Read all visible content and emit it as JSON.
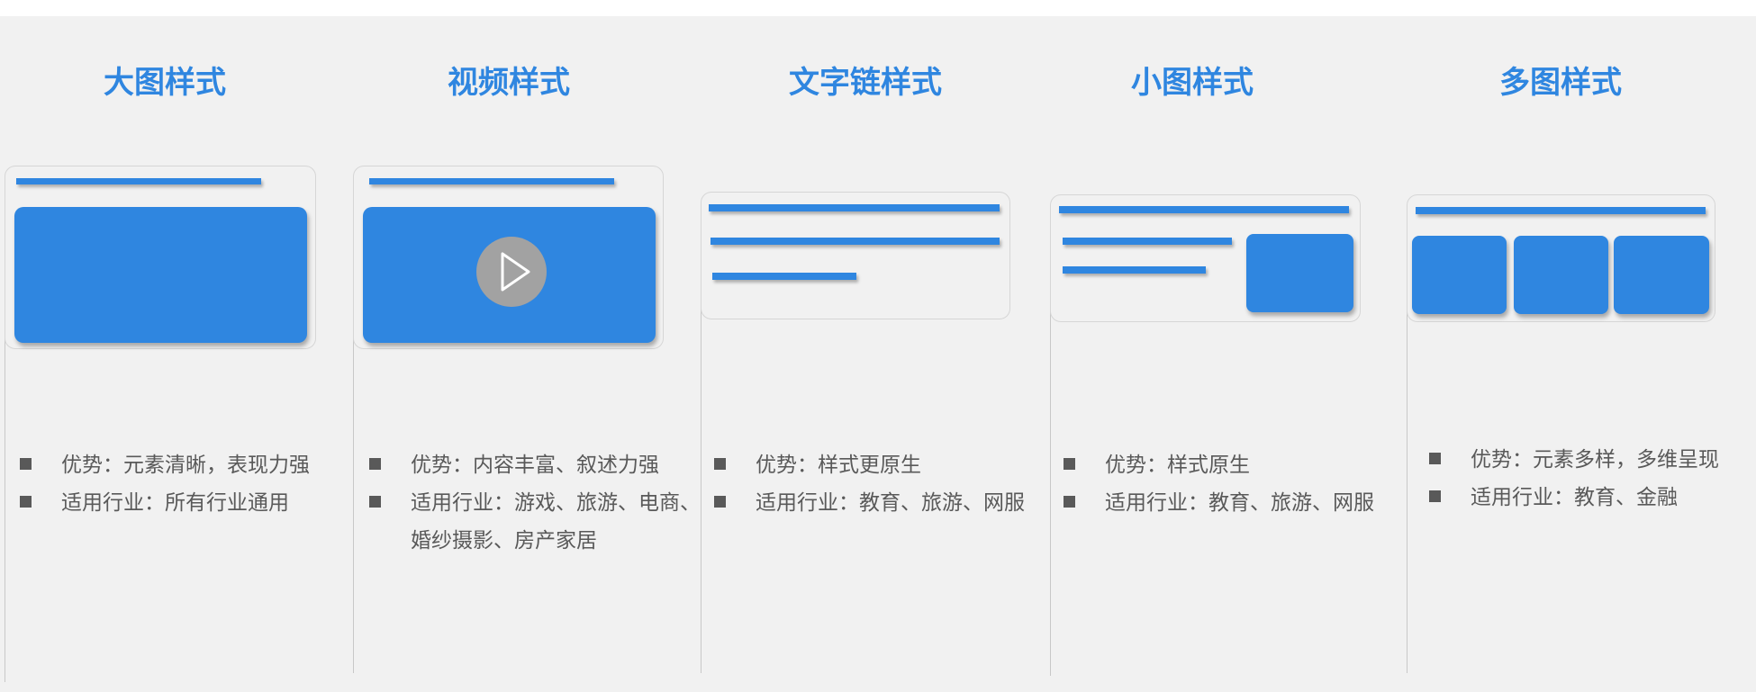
{
  "colors": {
    "accent": "#2f86e0",
    "panel_bg": "#f1f1f1",
    "text": "#595959",
    "border": "#d6d6d6",
    "play_button": "#a2a2a2"
  },
  "columns": [
    {
      "key": "large",
      "title": "大图样式",
      "bullets": [
        {
          "lines": [
            "优势：元素清晰，表现力强"
          ]
        },
        {
          "lines": [
            "适用行业：所有行业通用"
          ]
        }
      ]
    },
    {
      "key": "video",
      "title": "视频样式",
      "play_icon": "play-icon",
      "bullets": [
        {
          "lines": [
            "优势：内容丰富、叙述力强"
          ]
        },
        {
          "lines": [
            "适用行业：游戏、旅游、电商、",
            "婚纱摄影、房产家居"
          ]
        }
      ]
    },
    {
      "key": "text-link",
      "title": "文字链样式",
      "bullets": [
        {
          "lines": [
            "优势：样式更原生"
          ]
        },
        {
          "lines": [
            "适用行业：教育、旅游、网服"
          ]
        }
      ]
    },
    {
      "key": "small",
      "title": "小图样式",
      "bullets": [
        {
          "lines": [
            "优势：样式原生"
          ]
        },
        {
          "lines": [
            "适用行业：教育、旅游、网服"
          ]
        }
      ]
    },
    {
      "key": "multi",
      "title": "多图样式",
      "bullets": [
        {
          "lines": [
            "优势：元素多样，多维呈现"
          ]
        },
        {
          "lines": [
            "适用行业：教育、金融"
          ]
        }
      ]
    }
  ]
}
